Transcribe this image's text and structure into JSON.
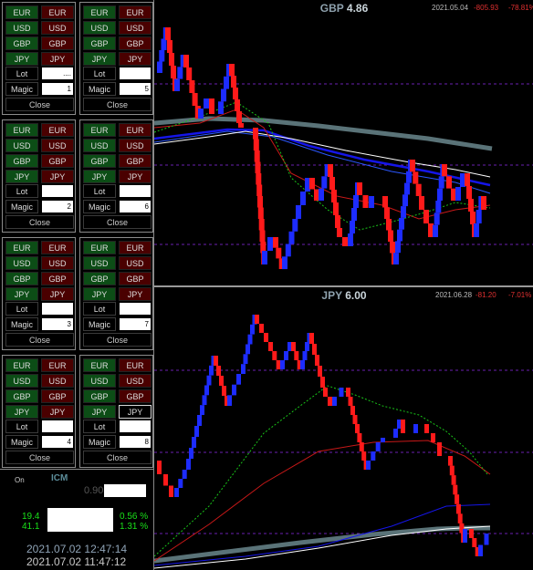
{
  "panels": [
    {
      "lot_value": "....",
      "magic_value": "1",
      "selected": null
    },
    {
      "lot_value": "",
      "magic_value": "5",
      "selected": null
    },
    {
      "lot_value": "",
      "magic_value": "2",
      "selected": null
    },
    {
      "lot_value": "",
      "magic_value": "6",
      "selected": null
    },
    {
      "lot_value": "",
      "magic_value": "3",
      "selected": null
    },
    {
      "lot_value": "",
      "magic_value": "7",
      "selected": null
    },
    {
      "lot_value": "",
      "magic_value": "4",
      "selected": null
    },
    {
      "lot_value": "",
      "magic_value": "8",
      "selected": "JPY"
    }
  ],
  "panel_labels": {
    "currencies": [
      "EUR",
      "USD",
      "GBP",
      "JPY"
    ],
    "lot": "Lot",
    "magic": "Magic",
    "close": "Close"
  },
  "status": {
    "on": "On",
    "broker": "ICM",
    "value_090": "0.90",
    "left_top": "19.4",
    "left_bottom": "41.1",
    "pct_top": "0.56 %",
    "pct_bottom": "1.31 %",
    "time1": "2021.07.02 12:47:14",
    "time2": "2021.07.02 11:47:12"
  },
  "charts": [
    {
      "symbol": "GBP",
      "value": "4.86",
      "date": "2021.05.04",
      "pnl": "-805.93",
      "pct": "-78.81%"
    },
    {
      "symbol": "JPY",
      "value": "6.00",
      "date": "2021.06.28",
      "pnl": "-81.20",
      "pct": "-7.01%"
    }
  ],
  "colors": {
    "buy": "#0c4d16",
    "sell": "#4a0000",
    "renko_up": "#1d2cff",
    "renko_down": "#ff1a1a",
    "grid": "#6a1fb0",
    "ma_gray": "#5a7378",
    "green": "#19e019",
    "time": "#8fa3b6"
  }
}
